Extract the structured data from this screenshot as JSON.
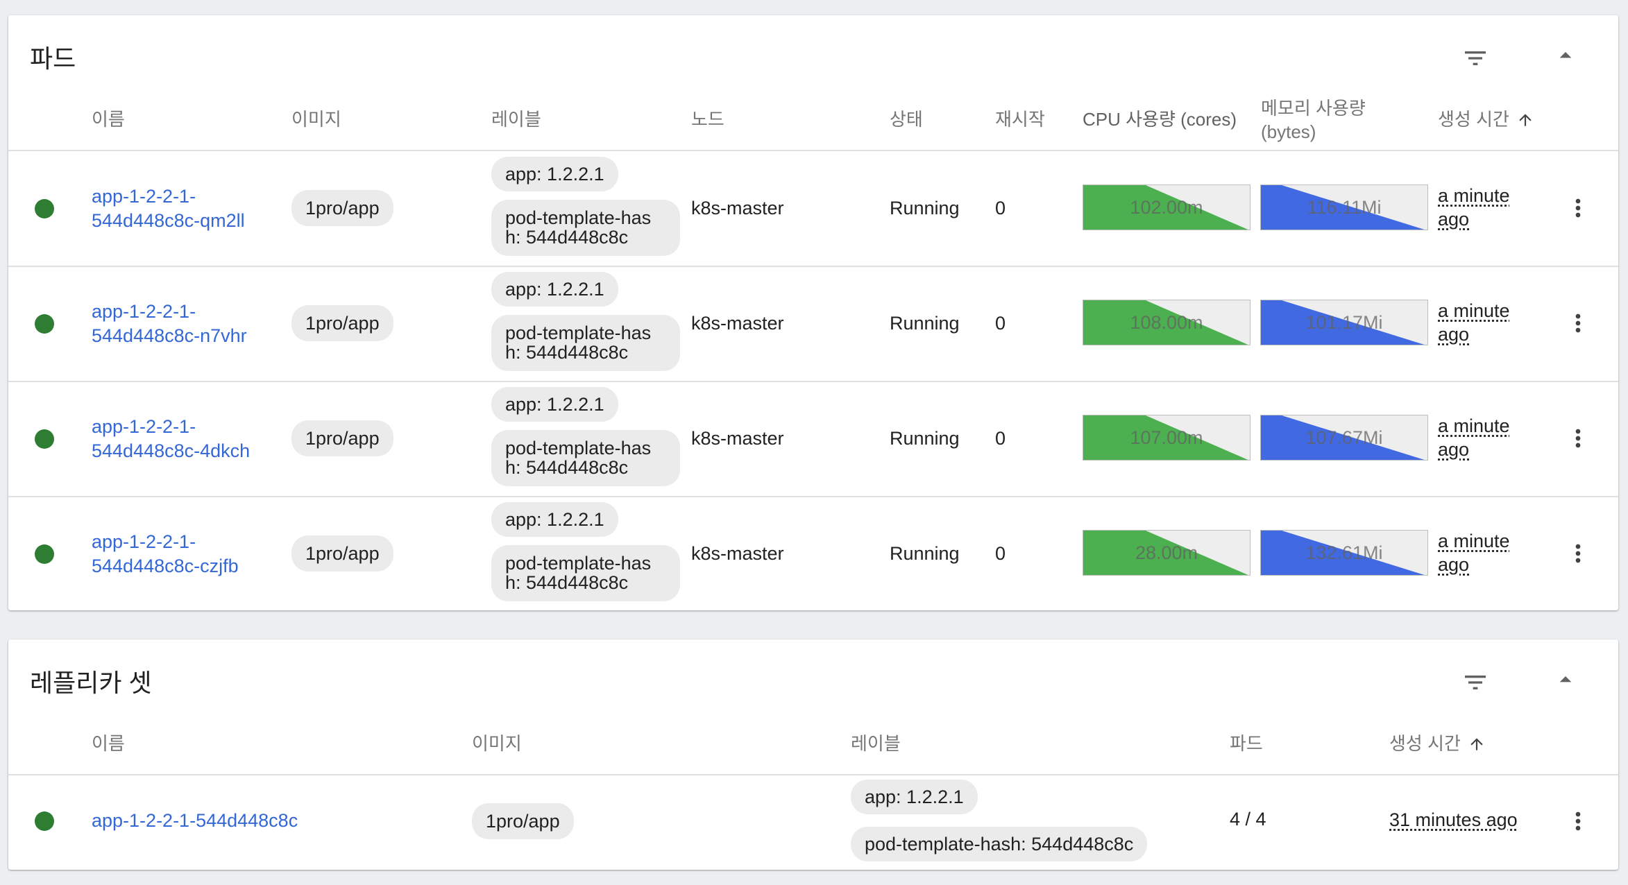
{
  "colors": {
    "link": "#3367d6",
    "status_ok": "#2e7d32",
    "cpu_fill": "#4caf50",
    "mem_fill": "#4169e1",
    "header_text": "#757575",
    "chip_bg": "#ebebeb"
  },
  "pods": {
    "title": "파드",
    "columns": {
      "name": "이름",
      "image": "이미지",
      "labels": "레이블",
      "node": "노드",
      "status": "상태",
      "restarts": "재시작",
      "cpu": "CPU 사용량 (cores)",
      "memory_line1": "메모리 사용량",
      "memory_line2": "(bytes)",
      "created": "생성 시간"
    },
    "icons": {
      "filter": "filter-list-icon",
      "collapse": "arrow-drop-up-icon",
      "sort": "arrow-upward-icon",
      "more": "more-vert-icon"
    },
    "rows": [
      {
        "name_line1": "app-1-2-2-1-",
        "name_line2": "544d448c8c-qm2ll",
        "image": "1pro/app",
        "label_app": "app: 1.2.2.1",
        "label_hash": "pod-template-hash: 544d448c8c",
        "node": "k8s-master",
        "status": "Running",
        "restarts": "0",
        "cpu": "102.00m",
        "memory": "116.11Mi",
        "created_line1": "a minute",
        "created_line2": "ago"
      },
      {
        "name_line1": "app-1-2-2-1-",
        "name_line2": "544d448c8c-n7vhr",
        "image": "1pro/app",
        "label_app": "app: 1.2.2.1",
        "label_hash": "pod-template-hash: 544d448c8c",
        "node": "k8s-master",
        "status": "Running",
        "restarts": "0",
        "cpu": "108.00m",
        "memory": "101.17Mi",
        "created_line1": "a minute",
        "created_line2": "ago"
      },
      {
        "name_line1": "app-1-2-2-1-",
        "name_line2": "544d448c8c-4dkch",
        "image": "1pro/app",
        "label_app": "app: 1.2.2.1",
        "label_hash": "pod-template-hash: 544d448c8c",
        "node": "k8s-master",
        "status": "Running",
        "restarts": "0",
        "cpu": "107.00m",
        "memory": "107.67Mi",
        "created_line1": "a minute",
        "created_line2": "ago"
      },
      {
        "name_line1": "app-1-2-2-1-",
        "name_line2": "544d448c8c-czjfb",
        "image": "1pro/app",
        "label_app": "app: 1.2.2.1",
        "label_hash": "pod-template-hash: 544d448c8c",
        "node": "k8s-master",
        "status": "Running",
        "restarts": "0",
        "cpu": "28.00m",
        "memory": "132.61Mi",
        "created_line1": "a minute",
        "created_line2": "ago"
      }
    ]
  },
  "replicasets": {
    "title": "레플리카 셋",
    "columns": {
      "name": "이름",
      "image": "이미지",
      "labels": "레이블",
      "pods": "파드",
      "created": "생성 시간"
    },
    "rows": [
      {
        "name": "app-1-2-2-1-544d448c8c",
        "image": "1pro/app",
        "label_app": "app: 1.2.2.1",
        "label_hash": "pod-template-hash: 544d448c8c",
        "pods": "4 / 4",
        "created": "31 minutes ago"
      }
    ]
  }
}
